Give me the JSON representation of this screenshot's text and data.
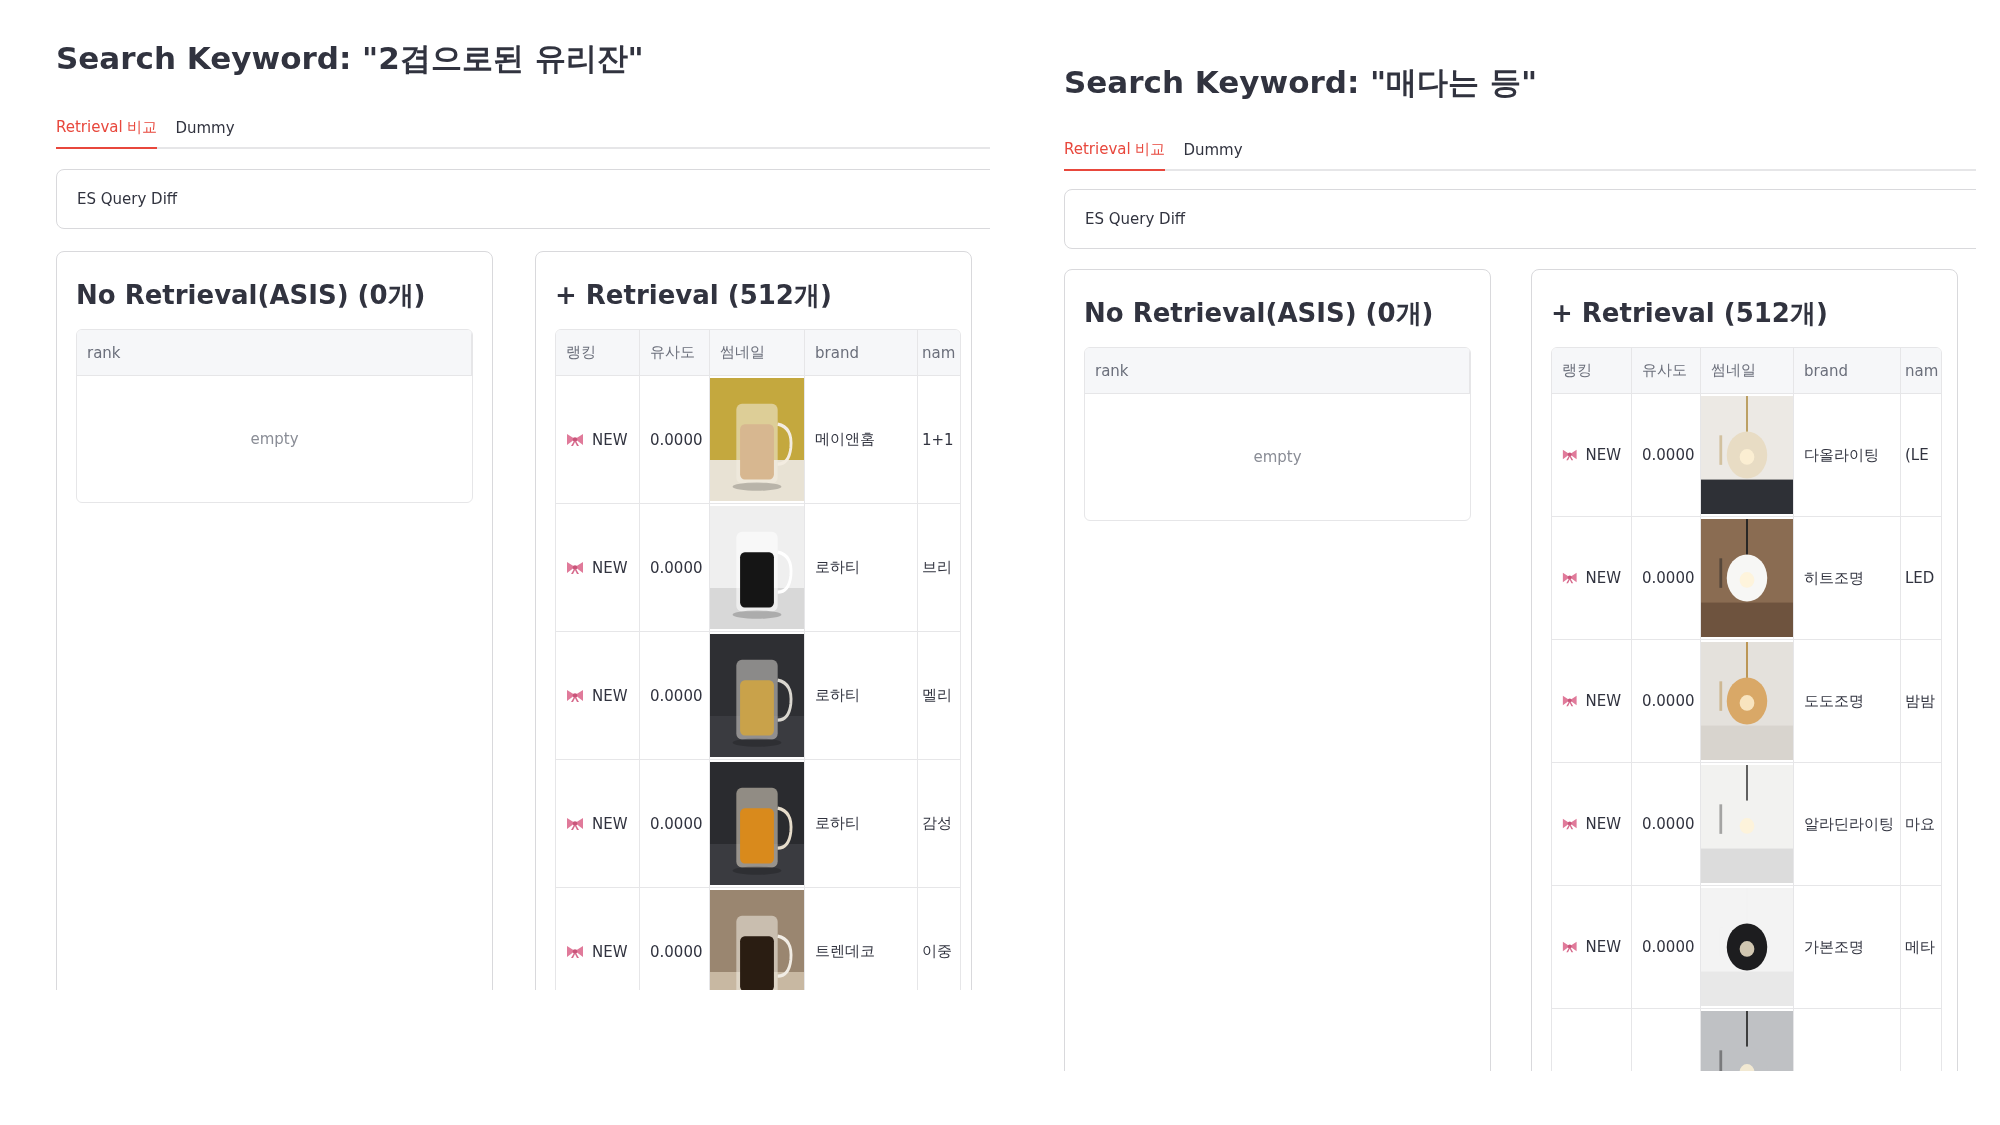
{
  "panels": [
    {
      "title": "Search Keyword: \"2겹으로된 유리잔\"",
      "tabs": [
        {
          "label": "Retrieval 비교",
          "selected": true
        },
        {
          "label": "Dummy",
          "selected": false
        }
      ],
      "expander": {
        "label": "ES Query Diff"
      },
      "cards": [
        {
          "kind": "empty",
          "title": "No Retrieval(ASIS) (0개)",
          "columns": [
            "rank"
          ],
          "empty_text": "empty"
        },
        {
          "kind": "table",
          "title": "+ Retrieval (512개)",
          "columns": [
            "랭킹",
            "유사도",
            "썸네일",
            "brand",
            "nam"
          ],
          "rows": [
            {
              "badge": "NEW",
              "score": "0.0000",
              "thumbnail": {
                "kind": "picture"
              },
              "brand": "메이앤홈",
              "name": "1+1"
            },
            {
              "badge": "NEW",
              "score": "0.0000",
              "thumbnail": {
                "kind": "picture"
              },
              "brand": "로하티",
              "name": "브리"
            },
            {
              "badge": "NEW",
              "score": "0.0000",
              "thumbnail": {
                "kind": "picture"
              },
              "brand": "로하티",
              "name": "멜리"
            },
            {
              "badge": "NEW",
              "score": "0.0000",
              "thumbnail": {
                "kind": "picture"
              },
              "brand": "로하티",
              "name": "감성"
            },
            {
              "badge": "NEW",
              "score": "0.0000",
              "thumbnail": {
                "kind": "picture"
              },
              "brand": "트렌데코",
              "name": "이중"
            }
          ]
        }
      ]
    },
    {
      "title": "Search Keyword: \"매다는 등\"",
      "tabs": [
        {
          "label": "Retrieval 비교",
          "selected": true
        },
        {
          "label": "Dummy",
          "selected": false
        }
      ],
      "expander": {
        "label": "ES Query Diff"
      },
      "cards": [
        {
          "kind": "empty",
          "title": "No Retrieval(ASIS) (0개)",
          "columns": [
            "rank"
          ],
          "empty_text": "empty"
        },
        {
          "kind": "table",
          "title": "+ Retrieval (512개)",
          "columns": [
            "랭킹",
            "유사도",
            "썸네일",
            "brand",
            "nam"
          ],
          "rows": [
            {
              "badge": "NEW",
              "score": "0.0000",
              "thumbnail": {
                "kind": "picture"
              },
              "brand": "다올라이팅",
              "name": "(LE"
            },
            {
              "badge": "NEW",
              "score": "0.0000",
              "thumbnail": {
                "kind": "picture"
              },
              "brand": "히트조명",
              "name": "LED"
            },
            {
              "badge": "NEW",
              "score": "0.0000",
              "thumbnail": {
                "kind": "picture"
              },
              "brand": "도도조명",
              "name": "밤밤"
            },
            {
              "badge": "NEW",
              "score": "0.0000",
              "thumbnail": {
                "kind": "picture"
              },
              "brand": "알라딘라이팅",
              "name": "마요"
            },
            {
              "badge": "NEW",
              "score": "0.0000",
              "thumbnail": {
                "kind": "picture"
              },
              "brand": "가본조명",
              "name": "메타"
            },
            {
              "thumbnail": {
                "kind": "picture"
              }
            }
          ]
        }
      ]
    }
  ]
}
